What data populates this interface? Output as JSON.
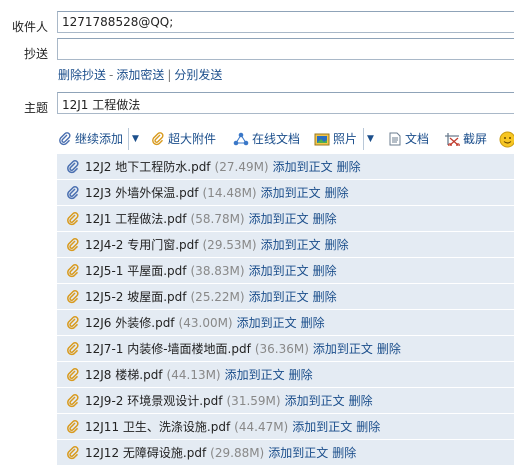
{
  "fields": {
    "to": {
      "label": "收件人",
      "value": "1271788528@QQ;"
    },
    "cc": {
      "label": "抄送",
      "value": ""
    },
    "subject": {
      "label": "主题",
      "value": "12J1 工程做法"
    }
  },
  "recipient_ops": {
    "remove_cc": "删除抄送",
    "dash": "-",
    "add_bcc": "添加密送",
    "bar": "|",
    "send_separately": "分别发送"
  },
  "toolbar": {
    "continue_add": "继续添加",
    "super_attachment": "超大附件",
    "online_doc": "在线文档",
    "photo": "照片",
    "document": "文档",
    "screenshot": "截屏"
  },
  "attachments": [
    {
      "name": "12J2 地下工程防水.pdf",
      "size": "(27.49M)",
      "add": "添加到正文",
      "del": "删除"
    },
    {
      "name": "12J3 外墙外保温.pdf",
      "size": "(14.48M)",
      "add": "添加到正文",
      "del": "删除"
    },
    {
      "name": "12J1 工程做法.pdf",
      "size": "(58.78M)",
      "add": "添加到正文",
      "del": "删除"
    },
    {
      "name": "12J4-2 专用门窗.pdf",
      "size": "(29.53M)",
      "add": "添加到正文",
      "del": "删除"
    },
    {
      "name": "12J5-1 平屋面.pdf",
      "size": "(38.83M)",
      "add": "添加到正文",
      "del": "删除"
    },
    {
      "name": "12J5-2 坡屋面.pdf",
      "size": "(25.22M)",
      "add": "添加到正文",
      "del": "删除"
    },
    {
      "name": "12J6 外装修.pdf",
      "size": "(43.00M)",
      "add": "添加到正文",
      "del": "删除"
    },
    {
      "name": "12J7-1 内装修-墙面楼地面.pdf",
      "size": "(36.36M)",
      "add": "添加到正文",
      "del": "删除"
    },
    {
      "name": "12J8 楼梯.pdf",
      "size": "(44.13M)",
      "add": "添加到正文",
      "del": "删除"
    },
    {
      "name": "12J9-2 环境景观设计.pdf",
      "size": "(31.59M)",
      "add": "添加到正文",
      "del": "删除"
    },
    {
      "name": "12J11 卫生、洗涤设施.pdf",
      "size": "(44.47M)",
      "add": "添加到正文",
      "del": "删除"
    },
    {
      "name": "12J12 无障碍设施.pdf",
      "size": "(29.88M)",
      "add": "添加到正文",
      "del": "删除"
    }
  ],
  "colors": {
    "link": "#1c4f8c",
    "row_bg": "#e4ebf3",
    "clip_blue": "#4a6fb0",
    "clip_gold": "#d89a1e"
  }
}
